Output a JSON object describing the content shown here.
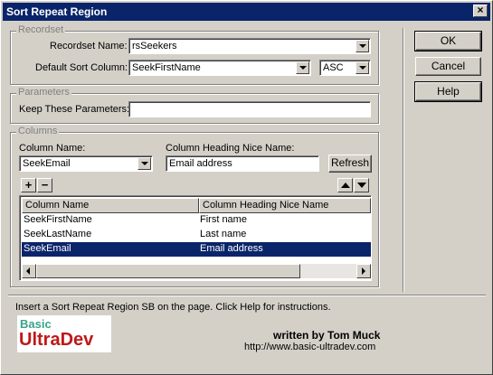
{
  "window": {
    "title": "Sort Repeat Region",
    "close_glyph": "×"
  },
  "recordset": {
    "legend": "Recordset",
    "name_label": "Recordset Name:",
    "name_value": "rsSeekers",
    "sort_label": "Default Sort Column:",
    "sort_value": "SeekFirstName",
    "order_value": "ASC"
  },
  "parameters": {
    "legend": "Parameters",
    "keep_label": "Keep These Parameters:",
    "keep_value": ""
  },
  "columns": {
    "legend": "Columns",
    "name_label": "Column Name:",
    "name_value": "SeekEmail",
    "heading_label": "Column Heading Nice Name:",
    "heading_value": "Email address",
    "refresh_label": "Refresh",
    "add_label": "+",
    "remove_label": "−",
    "table": {
      "headers": [
        "Column Name",
        "Column Heading Nice Name"
      ],
      "rows": [
        {
          "name": "SeekFirstName",
          "heading": "First name",
          "selected": false
        },
        {
          "name": "SeekLastName",
          "heading": "Last name",
          "selected": false
        },
        {
          "name": "SeekEmail",
          "heading": "Email address",
          "selected": true
        }
      ]
    }
  },
  "buttons": {
    "ok": "OK",
    "cancel": "Cancel",
    "help": "Help"
  },
  "footer": {
    "instructions": "Insert a Sort Repeat Region SB on the page. Click Help for instructions.",
    "logo_line1": "Basic",
    "logo_line2": "UltraDev",
    "author": "written by Tom Muck",
    "url": "http://www.basic-ultradev.com"
  },
  "colors": {
    "titlebar": "#0a246a",
    "selection": "#0a246a",
    "face": "#d4d0c8"
  }
}
